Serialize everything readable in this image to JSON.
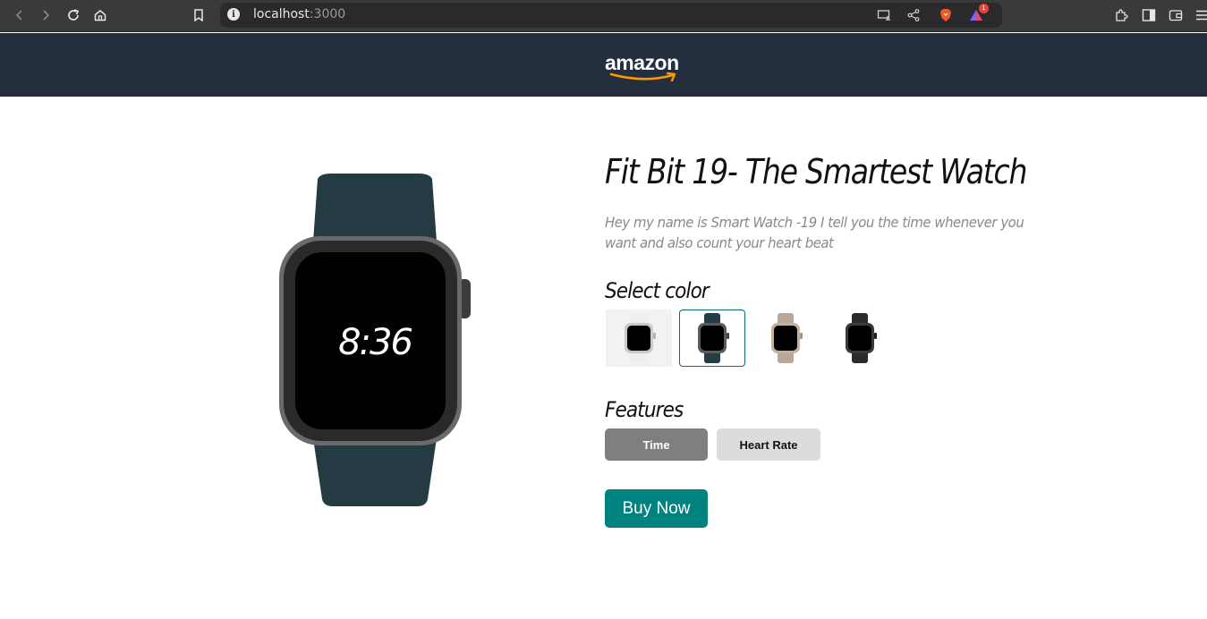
{
  "browser": {
    "url_host": "localhost",
    "url_port": ":3000",
    "notification_count": "1"
  },
  "site": {
    "logo_text": "amazon",
    "brand_color": "#232f3e"
  },
  "product": {
    "title": "Fit Bit 19- The Smartest Watch",
    "description": "Hey my name is Smart Watch -19 I tell you the time whenever you want and also count your heart beat",
    "watch_time": "8:36",
    "select_color_label": "Select color",
    "colors": [
      {
        "name": "white",
        "band": "#f0f0f0",
        "case": "#c9c9c9"
      },
      {
        "name": "navy",
        "band": "#253b45",
        "case": "#5a5a5c"
      },
      {
        "name": "gold",
        "band": "#b9a899",
        "case": "#c4b09c"
      },
      {
        "name": "black",
        "band": "#2b2b2b",
        "case": "#3a3a3a"
      }
    ],
    "selected_color_index": 1,
    "features_label": "Features",
    "features": [
      "Time",
      "Heart Rate"
    ],
    "active_feature": "Time",
    "buy_label": "Buy Now",
    "accent_color": "#00827f"
  }
}
